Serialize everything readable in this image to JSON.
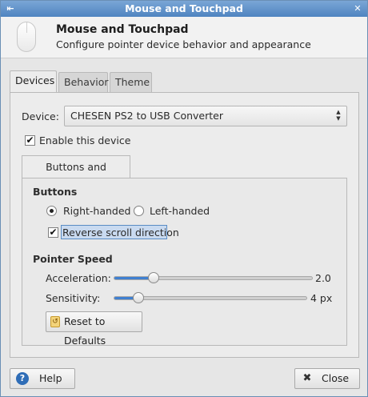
{
  "window": {
    "title": "Mouse and Touchpad",
    "left_button_glyph": "⇤",
    "right_button_glyph": "✕"
  },
  "header": {
    "title": "Mouse and Touchpad",
    "subtitle": "Configure pointer device behavior and appearance",
    "icon": "mouse-icon"
  },
  "tabs": [
    {
      "label": "Devices",
      "active": true
    },
    {
      "label": "Behavior",
      "active": false
    },
    {
      "label": "Theme",
      "active": false
    }
  ],
  "devices": {
    "device_label": "Device:",
    "device_value": "CHESEN PS2 to USB Converter",
    "enable_label": "Enable this device",
    "enable_checked": true,
    "inner_tab": "Buttons and Feedback",
    "buttons_section": "Buttons",
    "right_handed": "Right-handed",
    "left_handed": "Left-handed",
    "handedness_selected": "Right-handed",
    "reverse_scroll": "Reverse scroll direction",
    "reverse_scroll_checked": true,
    "pointer_section": "Pointer Speed",
    "acceleration_label": "Acceleration:",
    "acceleration_value": "2.0",
    "acceleration_fraction": 0.2,
    "sensitivity_label": "Sensitivity:",
    "sensitivity_value": "4 px",
    "sensitivity_fraction": 0.13,
    "reset_label": "Reset to Defaults"
  },
  "footer": {
    "help_label": "Help",
    "close_label": "Close"
  },
  "colors": {
    "titlebar": "#5b8fcc",
    "accent": "#3f7fd0"
  }
}
